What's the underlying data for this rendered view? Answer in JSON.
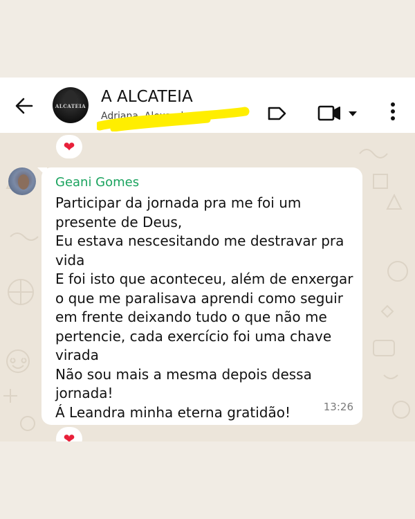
{
  "header": {
    "back_icon": "arrow-left-icon",
    "group_avatar_text": "ALCATEIA",
    "title": "A ALCATEIA",
    "subtitle": "Adriana, Alexandra, ...",
    "label_icon": "label-tag-icon",
    "video_icon": "video-camera-icon",
    "dropdown_icon": "caret-down-icon",
    "menu_icon": "more-vertical-icon",
    "highlight_color": "#ffee00"
  },
  "reactions": {
    "top": "❤",
    "bottom": "❤",
    "color": "#e8203a"
  },
  "message": {
    "sender": "Geani Gomes",
    "sender_color": "#1aa35e",
    "text": "Participar da jornada pra me foi um presente de Deus,\nEu estava nescesitando me destravar pra vida\nE foi isto que aconteceu, além de enxergar o que me paralisava aprendi como seguir em frente deixando tudo o que não me pertencie, cada exercício foi uma chave virada\nNão sou mais a mesma depois dessa jornada!\nÁ Leandra minha eterna gratidão!",
    "time": "13:26"
  }
}
